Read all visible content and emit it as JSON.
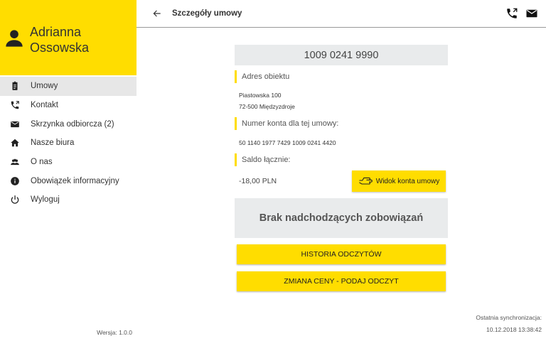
{
  "user": {
    "first_name": "Adrianna",
    "last_name": "Ossowska"
  },
  "nav": {
    "items": [
      {
        "label": "Umowy",
        "icon": "clipboard-icon",
        "active": true
      },
      {
        "label": "Kontakt",
        "icon": "phone-icon"
      },
      {
        "label": "Skrzynka odbiorcza (2)",
        "icon": "mail-icon"
      },
      {
        "label": "Nasze biura",
        "icon": "home-icon"
      },
      {
        "label": "O nas",
        "icon": "people-icon"
      },
      {
        "label": "Obowiązek informacyjny",
        "icon": "info-icon"
      },
      {
        "label": "Wyloguj",
        "icon": "power-icon"
      }
    ]
  },
  "version": "Wersja: 1.0.0",
  "header": {
    "title": "Szczegóły umowy"
  },
  "contract": {
    "number": "1009 0241 9990",
    "address_label": "Adres obiektu",
    "address_line1": "Piastowska 100",
    "address_line2": "72-500 Międzyzdroje",
    "account_label": "Numer konta dla tej umowy:",
    "account_number": "50 1140 1977 7429 1009 0241 4420",
    "balance_label": "Saldo łącznie:",
    "balance_value": "-18,00 PLN",
    "view_button": "Widok konta umowy",
    "no_obligations": "Brak nadchodzących zobowiązań",
    "history_button": "HISTORIA ODCZYTÓW",
    "price_change_button": "ZMIANA CENY - PODAJ ODCZYT"
  },
  "sync": {
    "label": "Ostatnia synchronizacja:",
    "value": "10.12.2018 13:38:42"
  },
  "colors": {
    "accent": "#FFDD00",
    "panel": "#e9ebec",
    "active_nav": "#e7e7e7"
  }
}
